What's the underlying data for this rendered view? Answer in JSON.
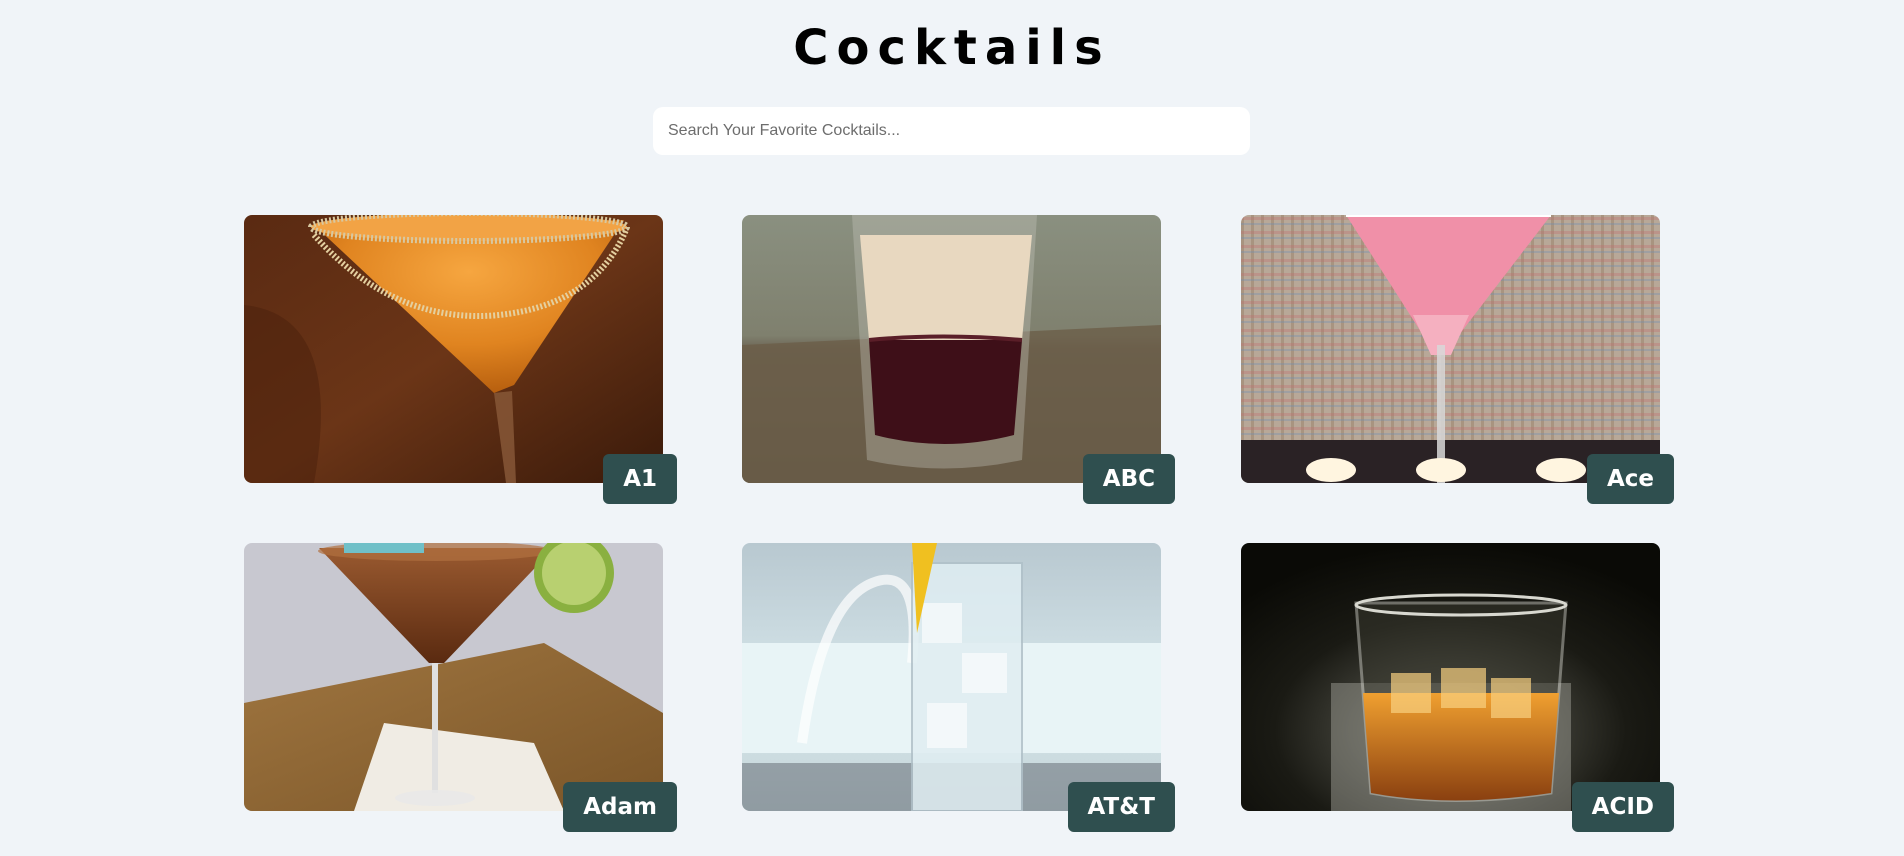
{
  "header": {
    "title": "Cocktails"
  },
  "search": {
    "placeholder": "Search Your Favorite Cocktails..."
  },
  "cocktails": [
    {
      "name": "A1"
    },
    {
      "name": "ABC"
    },
    {
      "name": "Ace"
    },
    {
      "name": "Adam"
    },
    {
      "name": "AT&T"
    },
    {
      "name": "ACID"
    }
  ],
  "colors": {
    "background": "#f0f4f8",
    "label_bg": "#2f4f4f",
    "label_text": "#ffffff"
  }
}
